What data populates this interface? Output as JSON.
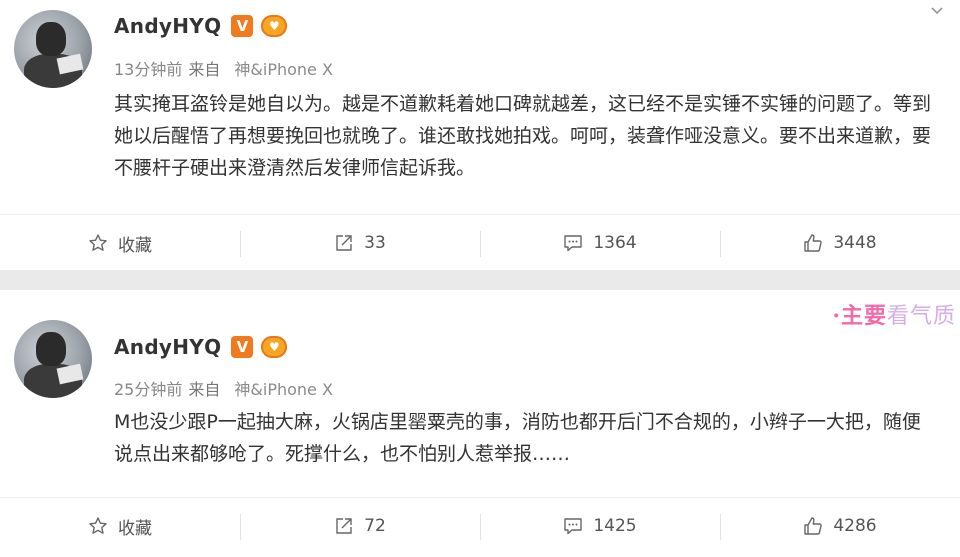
{
  "posts": [
    {
      "username": "AndyHYQ",
      "verified_badge": "V",
      "fan_badge": "粉",
      "time": "13分钟前",
      "from_label": "来自",
      "device": "神&iPhone X",
      "content": "其实掩耳盗铃是她自以为。越是不道歉耗着她口碑就越差，这已经不是实锤不实锤的问题了。等到她以后醒悟了再想要挽回也就晚了。谁还敢找她拍戏。呵呵，装聋作哑没意义。要不出来道歉，要不腰杆子硬出来澄清然后发律师信起诉我。",
      "actions": {
        "favorite_label": "收藏",
        "repost_count": "33",
        "comment_count": "1364",
        "like_count": "3448"
      }
    },
    {
      "username": "AndyHYQ",
      "verified_badge": "V",
      "fan_badge": "粉",
      "time": "25分钟前",
      "from_label": "来自",
      "device": "神&iPhone X",
      "content": "M也没少跟P一起抽大麻，火锅店里罂粟壳的事，消防也都开后门不合规的，小辫子一大把，随便说点出来都够呛了。死撑什么，也不怕别人惹举报……",
      "actions": {
        "favorite_label": "收藏",
        "repost_count": "72",
        "comment_count": "1425",
        "like_count": "4286"
      }
    }
  ],
  "watermark": {
    "main": "·主要",
    "faded": "看气质"
  },
  "colors": {
    "badge_orange": "#f07b1f",
    "watermark_pink": "#f25aa0",
    "text": "#333333",
    "meta": "#888888"
  }
}
